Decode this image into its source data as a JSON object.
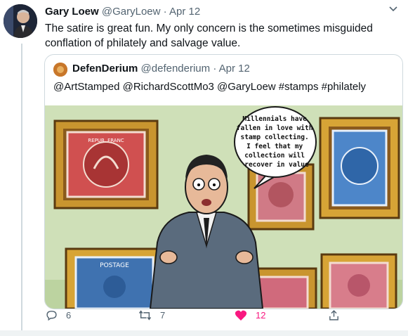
{
  "tweet": {
    "author_name": "Gary Loew",
    "author_handle": "@GaryLoew",
    "separator": "·",
    "date": "Apr 12",
    "text": "The satire is great fun. My only concern is the sometimes misguided conflation of philately and salvage value."
  },
  "quoted_tweet": {
    "author_name": "DefenDerium",
    "author_handle": "@defenderium",
    "separator": "·",
    "date": "Apr 12",
    "text": "@ArtStamped @RichardScottMo3 @GaryLoew #stamps #philately",
    "image": {
      "speech_bubble": [
        "Millennials have",
        "fallen in love with",
        "stamp collecting.",
        "I feel that my",
        "collection will",
        "recover in value"
      ],
      "stamp_labels": [
        "REPUB. FRANC",
        "POSTAGE"
      ]
    }
  },
  "actions": {
    "reply_count": "6",
    "retweet_count": "7",
    "like_count": "12",
    "like_color": "#f91880"
  }
}
